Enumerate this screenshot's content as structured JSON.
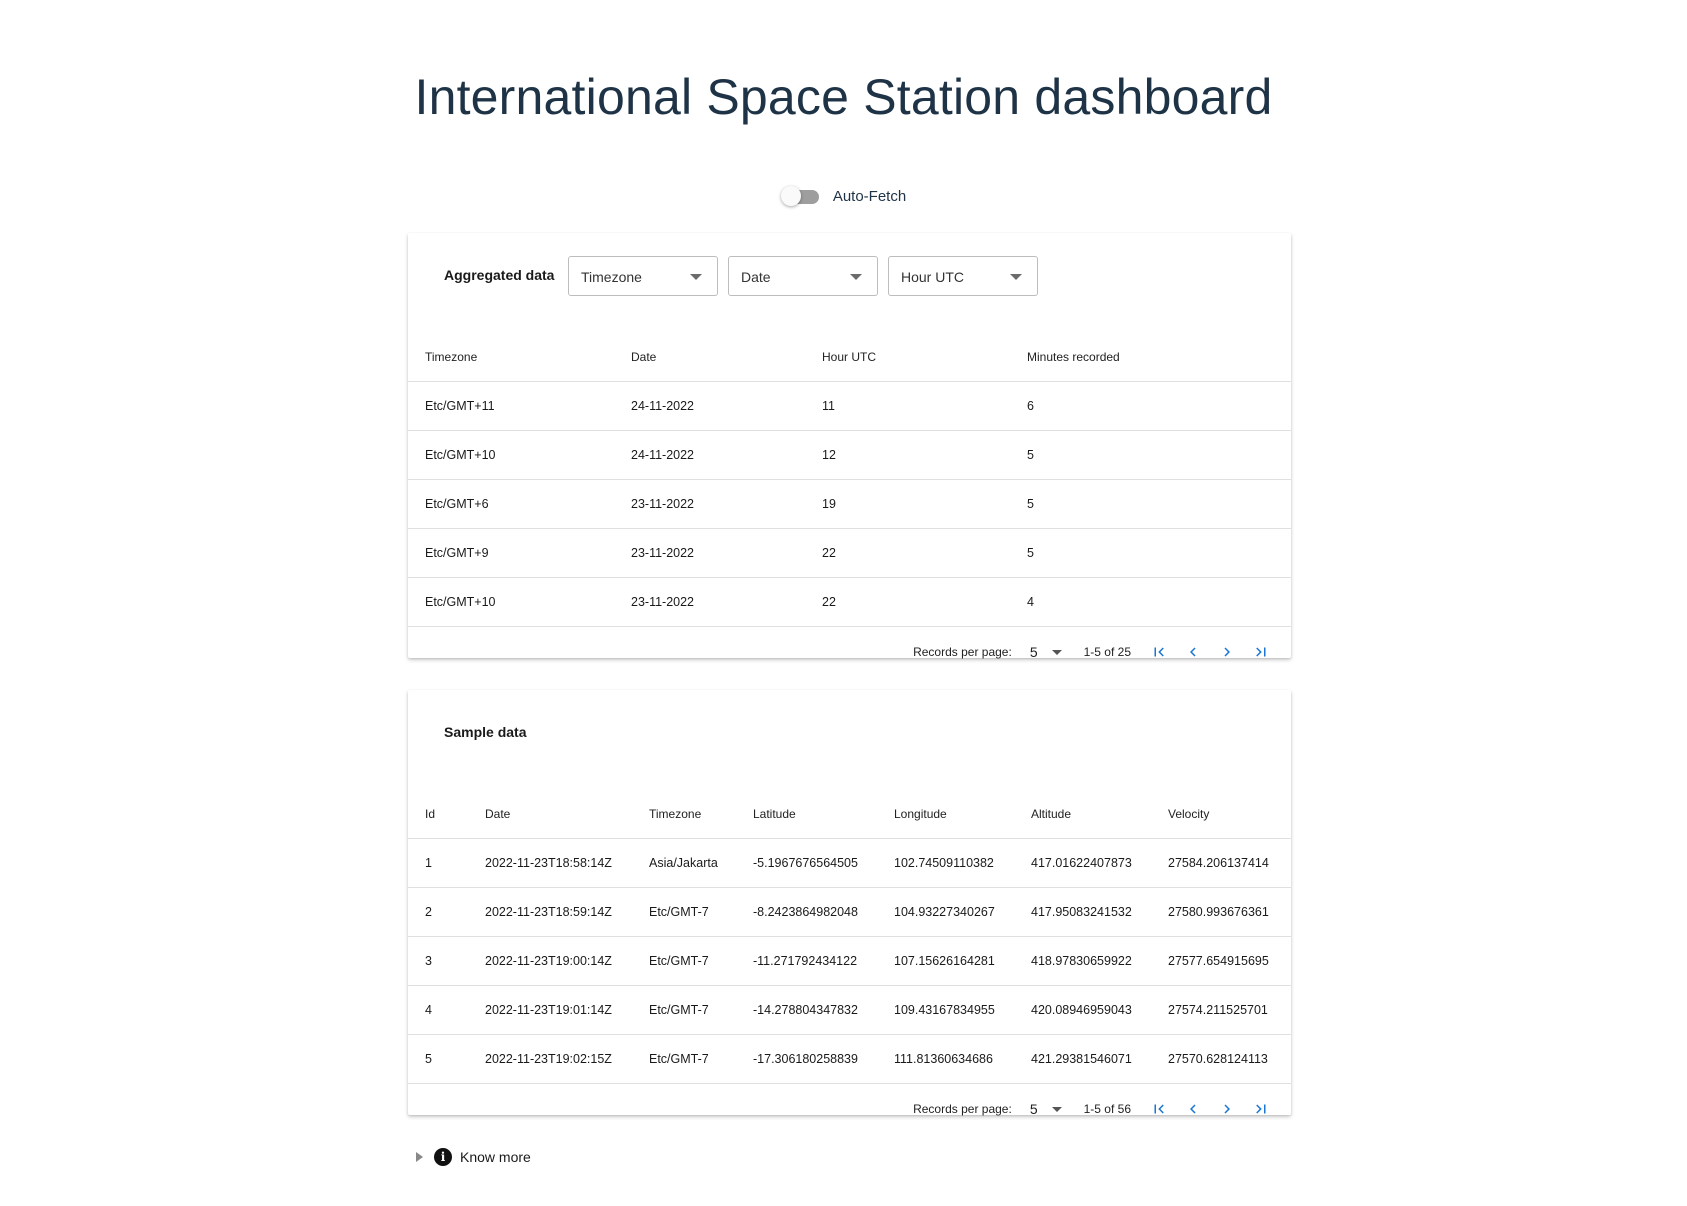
{
  "page": {
    "title": "International Space Station dashboard"
  },
  "auto_fetch": {
    "label": "Auto-Fetch",
    "enabled": false
  },
  "aggregated": {
    "title": "Aggregated data",
    "filters": [
      {
        "label": "Timezone"
      },
      {
        "label": "Date"
      },
      {
        "label": "Hour UTC"
      }
    ],
    "columns": [
      "Timezone",
      "Date",
      "Hour UTC",
      "Minutes recorded"
    ],
    "rows": [
      [
        "Etc/GMT+11",
        "24-11-2022",
        "11",
        "6"
      ],
      [
        "Etc/GMT+10",
        "24-11-2022",
        "12",
        "5"
      ],
      [
        "Etc/GMT+6",
        "23-11-2022",
        "19",
        "5"
      ],
      [
        "Etc/GMT+9",
        "23-11-2022",
        "22",
        "5"
      ],
      [
        "Etc/GMT+10",
        "23-11-2022",
        "22",
        "4"
      ]
    ],
    "pagination": {
      "records_label": "Records per page:",
      "records_value": "5",
      "range": "1-5 of 25"
    }
  },
  "sample": {
    "title": "Sample data",
    "columns": [
      "Id",
      "Date",
      "Timezone",
      "Latitude",
      "Longitude",
      "Altitude",
      "Velocity"
    ],
    "rows": [
      [
        "1",
        "2022-11-23T18:58:14Z",
        "Asia/Jakarta",
        "-5.1967676564505",
        "102.74509110382",
        "417.01622407873",
        "27584.206137414"
      ],
      [
        "2",
        "2022-11-23T18:59:14Z",
        "Etc/GMT-7",
        "-8.2423864982048",
        "104.93227340267",
        "417.95083241532",
        "27580.993676361"
      ],
      [
        "3",
        "2022-11-23T19:00:14Z",
        "Etc/GMT-7",
        "-11.271792434122",
        "107.15626164281",
        "418.97830659922",
        "27577.654915695"
      ],
      [
        "4",
        "2022-11-23T19:01:14Z",
        "Etc/GMT-7",
        "-14.278804347832",
        "109.43167834955",
        "420.08946959043",
        "27574.211525701"
      ],
      [
        "5",
        "2022-11-23T19:02:15Z",
        "Etc/GMT-7",
        "-17.306180258839",
        "111.81360634686",
        "421.29381546071",
        "27570.628124113"
      ]
    ],
    "pagination": {
      "records_label": "Records per page:",
      "records_value": "5",
      "range": "1-5 of 56"
    }
  },
  "know_more": {
    "label": "Know more",
    "icon": "info-icon"
  },
  "colors": {
    "title": "#1f3347",
    "pager_icon": "#1976d2",
    "divider": "#e0e0e0"
  }
}
